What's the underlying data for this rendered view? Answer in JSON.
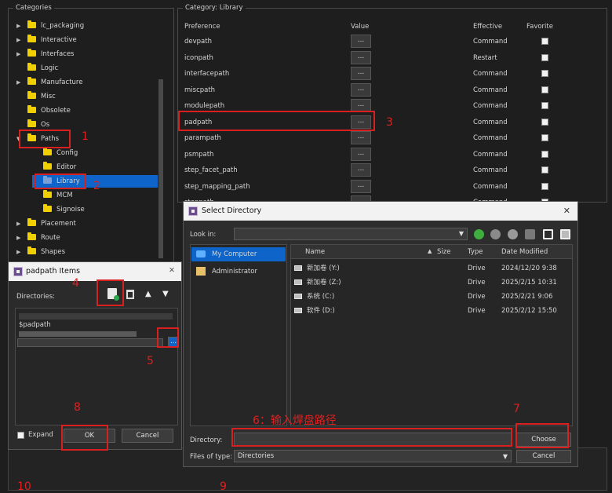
{
  "categories_panel": {
    "title": "Categories",
    "items": [
      {
        "label": "lc_packaging",
        "arrow": "▶"
      },
      {
        "label": "Interactive",
        "arrow": "▶"
      },
      {
        "label": "Interfaces",
        "arrow": "▶"
      },
      {
        "label": "Logic",
        "arrow": ""
      },
      {
        "label": "Manufacture",
        "arrow": "▶"
      },
      {
        "label": "Misc",
        "arrow": ""
      },
      {
        "label": "Obsolete",
        "arrow": ""
      },
      {
        "label": "Os",
        "arrow": ""
      },
      {
        "label": "Paths",
        "arrow": "▼"
      },
      {
        "label": "Config",
        "arrow": ""
      },
      {
        "label": "Editor",
        "arrow": ""
      },
      {
        "label": "Library",
        "arrow": ""
      },
      {
        "label": "MCM",
        "arrow": ""
      },
      {
        "label": "Signoise",
        "arrow": ""
      },
      {
        "label": "Placement",
        "arrow": "▶"
      },
      {
        "label": "Route",
        "arrow": "▶"
      },
      {
        "label": "Shapes",
        "arrow": "▶"
      }
    ]
  },
  "library_panel": {
    "title": "Category:  Library",
    "headers": {
      "preference": "Preference",
      "value": "Value",
      "effective": "Effective",
      "favorite": "Favorite"
    },
    "button_label": "...",
    "rows": [
      {
        "preference": "devpath",
        "effective": "Command"
      },
      {
        "preference": "iconpath",
        "effective": "Restart"
      },
      {
        "preference": "interfacepath",
        "effective": "Command"
      },
      {
        "preference": "miscpath",
        "effective": "Command"
      },
      {
        "preference": "modulepath",
        "effective": "Command"
      },
      {
        "preference": "padpath",
        "effective": "Command"
      },
      {
        "preference": "parampath",
        "effective": "Command"
      },
      {
        "preference": "psmpath",
        "effective": "Command"
      },
      {
        "preference": "step_facet_path",
        "effective": "Command"
      },
      {
        "preference": "step_mapping_path",
        "effective": "Command"
      },
      {
        "preference": "steppath",
        "effective": "Command"
      }
    ]
  },
  "padpath_dialog": {
    "title": "padpath Items",
    "directories_label": "Directories:",
    "entry": "$padpath",
    "browse_label": "...",
    "expand_label": "Expand",
    "ok_label": "OK",
    "cancel_label": "Cancel",
    "close_symbol": "✕",
    "up_symbol": "▲",
    "down_symbol": "▼"
  },
  "select_dialog": {
    "title": "Select Directory",
    "close_symbol": "✕",
    "look_in_label": "Look in:",
    "sidebar": [
      "My Computer",
      "Administrator"
    ],
    "columns": {
      "name": "Name",
      "size": "Size",
      "type": "Type",
      "date": "Date Modified"
    },
    "files": [
      {
        "name": "新加卷 (Y:)",
        "type": "Drive",
        "date": "2024/12/20 9:38"
      },
      {
        "name": "新加卷 (Z:)",
        "type": "Drive",
        "date": "2025/2/15 10:31"
      },
      {
        "name": "系统 (C:)",
        "type": "Drive",
        "date": "2025/2/21 9:06"
      },
      {
        "name": "软件 (D:)",
        "type": "Drive",
        "date": "2025/2/12 15:50"
      }
    ],
    "directory_label": "Directory:",
    "files_of_type_label": "Files of type:",
    "files_of_type_value": "Directories",
    "choose_label": "Choose",
    "cancel_label": "Cancel"
  },
  "annotations": {
    "n1": "1",
    "n2": "2",
    "n3": "3",
    "n4": "4",
    "n5": "5",
    "n6": "6：输入焊盘路径",
    "n7": "7",
    "n8": "8",
    "n9": "9",
    "n10": "10"
  },
  "colors": {
    "annotation": "#d92020",
    "selection": "#0e64c8",
    "folder": "#f0d000"
  }
}
